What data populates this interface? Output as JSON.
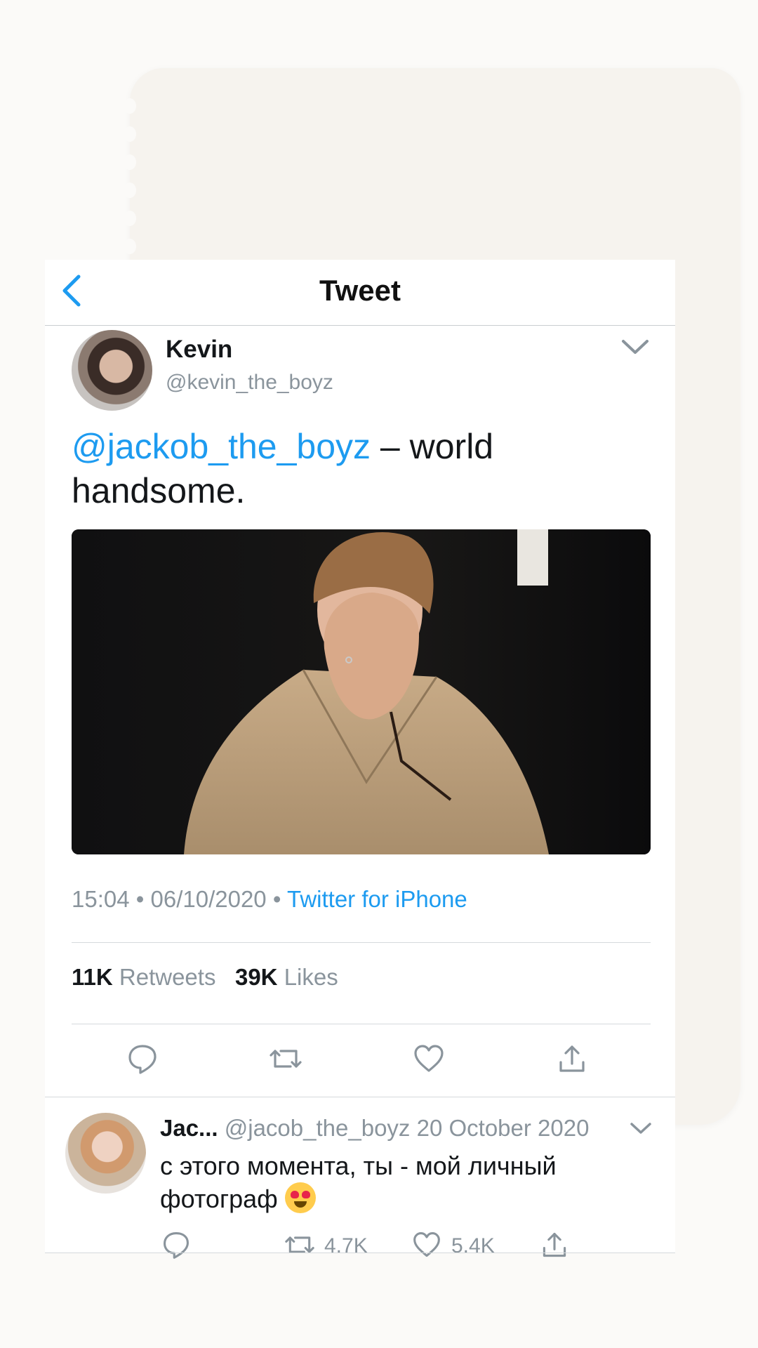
{
  "header": {
    "title": "Tweet"
  },
  "tweet": {
    "author_name": "Kevin",
    "author_handle": "@kevin_the_boyz",
    "mention": "@jackob_the_boyz",
    "text_rest": " – world handsome.",
    "time": "15:04",
    "date": "06/10/2020",
    "separator": "•",
    "source": "Twitter for iPhone",
    "retweets_count": "11K",
    "retweets_label": "Retweets",
    "likes_count": "39K",
    "likes_label": "Likes"
  },
  "reply": {
    "author_name": "Jac...",
    "author_handle": "@jacob_the_boyz",
    "date": "20 October 2020",
    "text": "с этого момента, ты - мой личный фотограф",
    "retweet_count": "4.7K",
    "like_count": "5.4K"
  },
  "colors": {
    "accent": "#1d9bf0",
    "muted_text": "#8a949c",
    "primary_text": "#14171a"
  }
}
